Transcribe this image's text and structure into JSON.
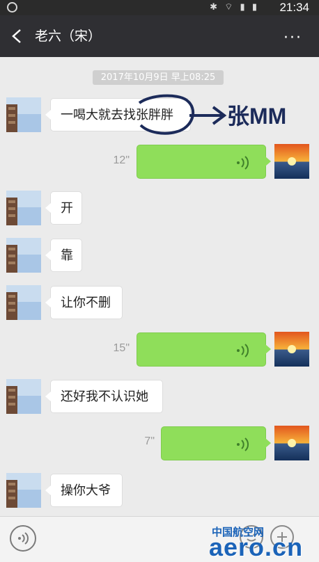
{
  "status_bar": {
    "icons": "✱ ⌔ ▮ ▮",
    "time": "21:34"
  },
  "header": {
    "title": "老六（宋）",
    "more_label": "···"
  },
  "chat": {
    "timestamp": "2017年10月9日 早上08:25",
    "messages": [
      {
        "side": "left",
        "type": "text",
        "text": "一喝大就去找张胖胖"
      },
      {
        "side": "right",
        "type": "voice",
        "duration": "12\""
      },
      {
        "side": "left",
        "type": "text",
        "text": "开"
      },
      {
        "side": "left",
        "type": "text",
        "text": "靠"
      },
      {
        "side": "left",
        "type": "text",
        "text": "让你不删"
      },
      {
        "side": "right",
        "type": "voice",
        "duration": "15\""
      },
      {
        "side": "left",
        "type": "text",
        "text": "还好我不认识她"
      },
      {
        "side": "right",
        "type": "voice",
        "duration": "7\""
      },
      {
        "side": "left",
        "type": "text",
        "text": "操你大爷"
      }
    ]
  },
  "annotation": {
    "text": "张MM"
  },
  "watermark": {
    "top": "中国航空网",
    "main": "aero.cn"
  },
  "colors": {
    "voice_bubble": "#8fde5a",
    "header_bg": "#2f2f33",
    "chat_bg": "#ebebeb",
    "watermark": "#1b63b8"
  }
}
